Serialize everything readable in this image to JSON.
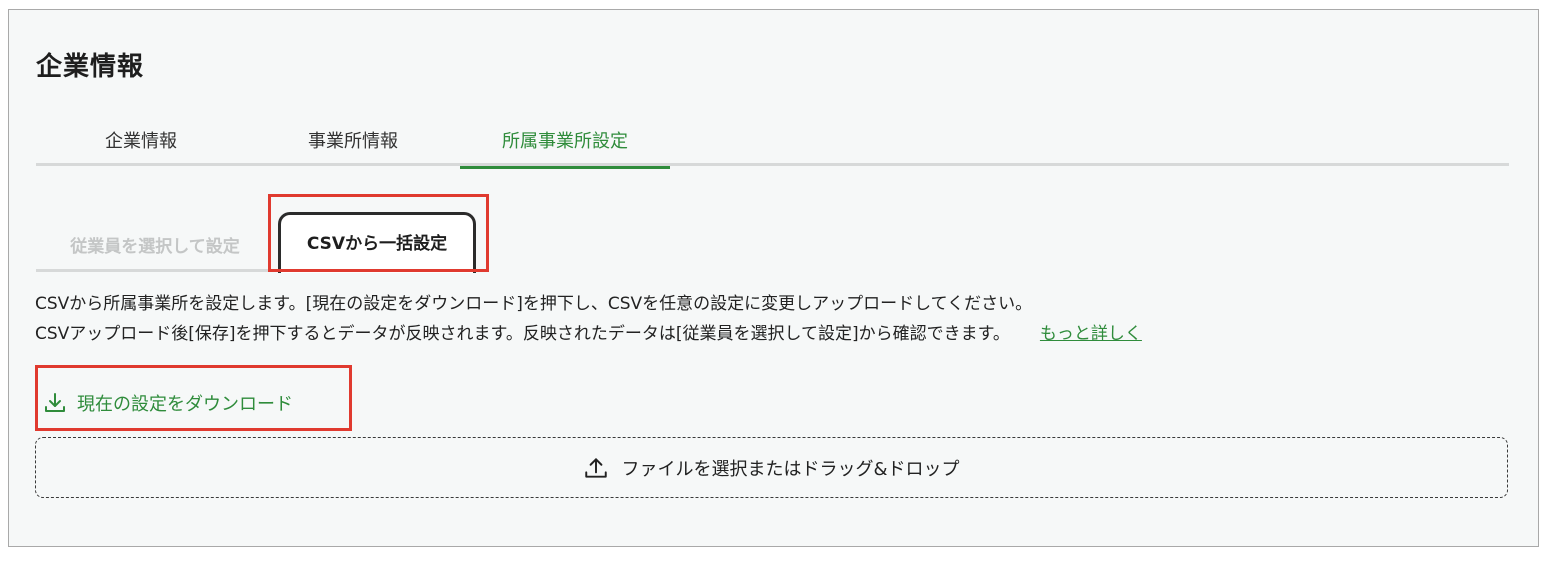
{
  "page": {
    "title": "企業情報"
  },
  "main_tabs": [
    {
      "label": "企業情報",
      "active": false
    },
    {
      "label": "事業所情報",
      "active": false
    },
    {
      "label": "所属事業所設定",
      "active": true
    }
  ],
  "sub_tabs": [
    {
      "label": "従業員を選択して設定",
      "active": false
    },
    {
      "label": "CSVから一括設定",
      "active": true
    }
  ],
  "description": {
    "line1": "CSVから所属事業所を設定します。[現在の設定をダウンロード]を押下し、CSVを任意の設定に変更しアップロードしてください。",
    "line2": "CSVアップロード後[保存]を押下するとデータが反映されます。反映されたデータは[従業員を選択して設定]から確認できます。",
    "more_link": "もっと詳しく"
  },
  "download": {
    "label": "現在の設定をダウンロード",
    "icon": "download-icon"
  },
  "dropzone": {
    "label": "ファイルを選択またはドラッグ&ドロップ",
    "icon": "upload-icon"
  },
  "colors": {
    "accent": "#2f8c3b",
    "highlight": "#e03a2f",
    "panel_bg": "#f6f8f8",
    "inactive_text": "#c4c6c6"
  }
}
